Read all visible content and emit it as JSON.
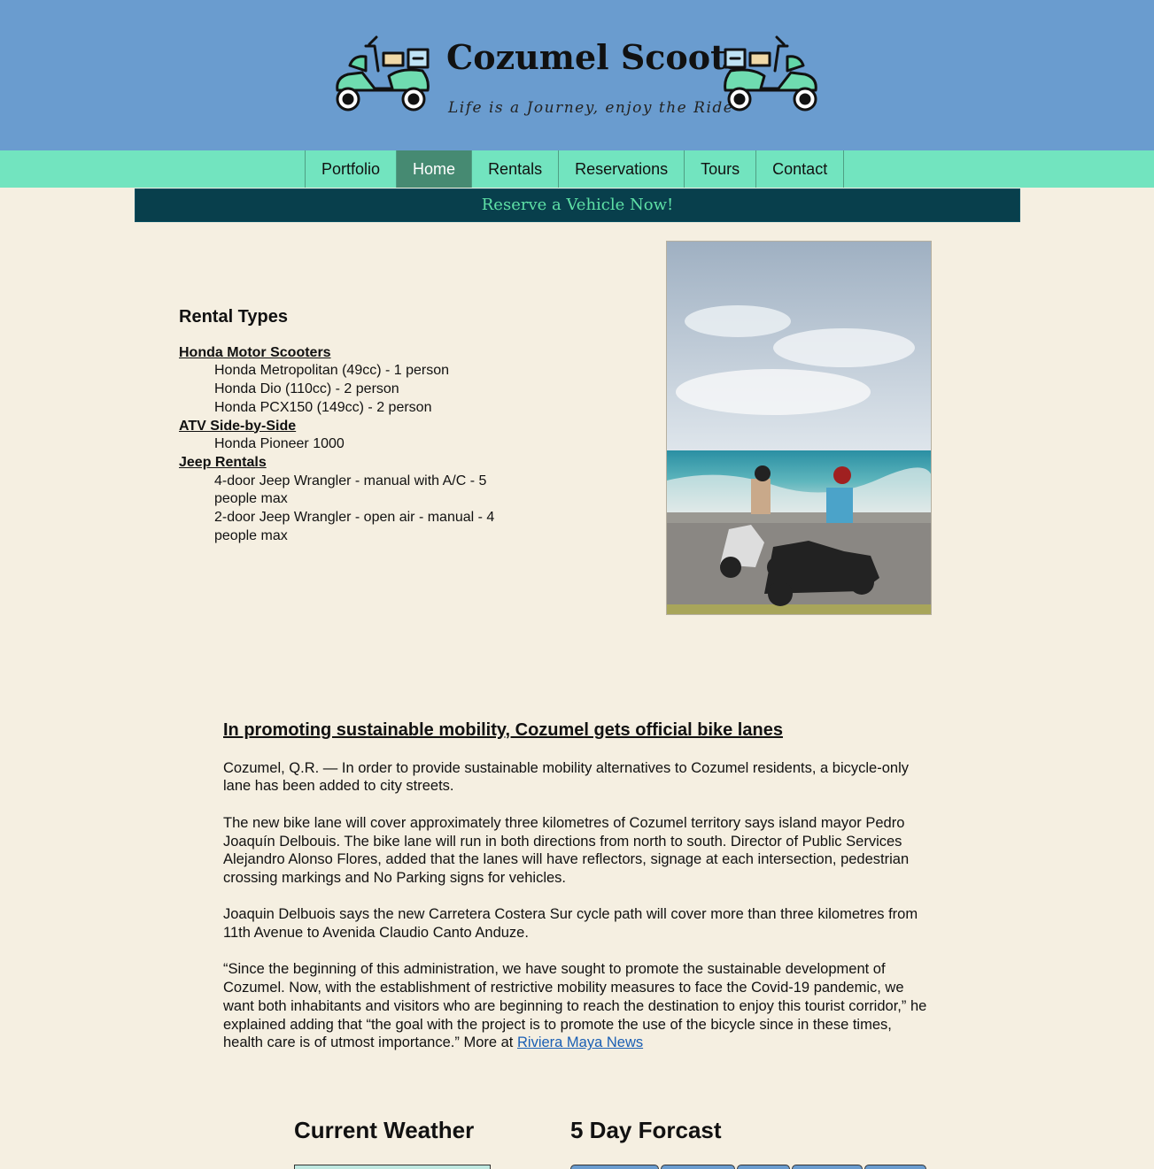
{
  "header": {
    "title": "Cozumel Scoots",
    "tagline": "Life is a Journey, enjoy the Ride"
  },
  "nav": {
    "items": [
      {
        "label": "Portfolio",
        "active": false
      },
      {
        "label": "Home",
        "active": true
      },
      {
        "label": "Rentals",
        "active": false
      },
      {
        "label": "Reservations",
        "active": false
      },
      {
        "label": "Tours",
        "active": false
      },
      {
        "label": "Contact",
        "active": false
      }
    ]
  },
  "reserve": {
    "label": "Reserve a Vehicle Now!"
  },
  "rental": {
    "heading": "Rental Types",
    "cat_scooters": "Honda Motor Scooters",
    "scooter_1": "Honda Metropolitan (49cc) - 1 person",
    "scooter_2": "Honda Dio (110cc) - 2 person",
    "scooter_3": "Honda PCX150 (149cc) - 2 person",
    "cat_atv": "ATV Side-by-Side",
    "atv_1": "Honda Pioneer 1000",
    "cat_jeep": "Jeep Rentals",
    "jeep_1": "4-door Jeep Wrangler - manual with A/C - 5 people max",
    "jeep_2": "2-door Jeep Wrangler - open air - manual - 4 people max"
  },
  "article": {
    "headline": "In promoting sustainable mobility, Cozumel gets official bike lanes",
    "p1": "Cozumel, Q.R. — In order to provide sustainable mobility alternatives to Cozumel residents, a bicycle-only lane has been added to city streets.",
    "p2": "The new bike lane will cover approximately three kilometres of Cozumel territory says island mayor Pedro Joaquín Delbouis. The bike lane will run in both directions from north to south. Director of Public Services Alejandro Alonso Flores, added that the lanes will have reflectors, signage at each intersection, pedestrian crossing markings and No Parking signs for vehicles.",
    "p3": "Joaquin Delbuois says the new Carretera Costera Sur cycle path will cover more than three kilometres from 11th Avenue to Avenida Claudio Canto Anduze.",
    "p4": "“Since the beginning of this administration, we have sought to promote the sustainable development of Cozumel. Now, with the establishment of restrictive mobility measures to face the Covid-19 pandemic, we want both inhabitants and visitors who are beginning to reach the destination to enjoy this tourist corridor,” he explained adding that “the goal with the project is to promote the use of the bicycle since in these times, health care is of utmost importance.” More at ",
    "link": "Riviera Maya News"
  },
  "weather": {
    "current_title": "Current Weather",
    "forecast_title": "5 Day Forcast"
  },
  "colors": {
    "header_bg": "#6a9ccf",
    "nav_bg": "#72e4bf",
    "nav_active": "#468a72",
    "reserve_bg": "#083f4c",
    "reserve_text": "#5ee0a6",
    "page_bg": "#f5efe1",
    "link": "#1a5fb4"
  },
  "icons": [
    "scooter-icon"
  ]
}
